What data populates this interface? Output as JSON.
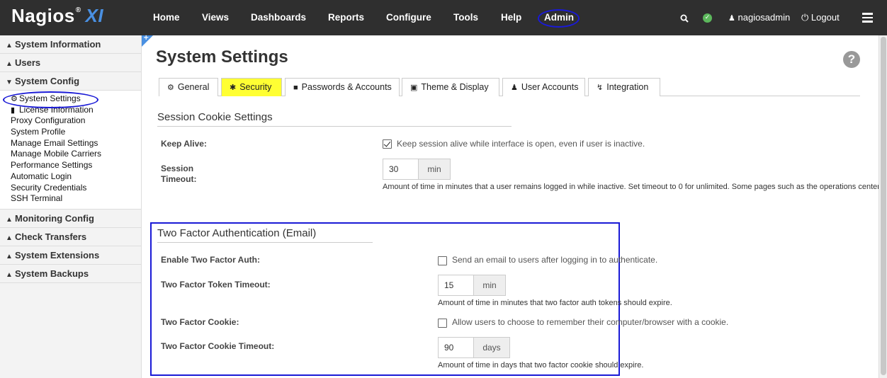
{
  "brand": {
    "name": "Nagios",
    "reg": "®",
    "suffix": "XI"
  },
  "topnav": {
    "items": [
      "Home",
      "Views",
      "Dashboards",
      "Reports",
      "Configure",
      "Tools",
      "Help",
      "Admin"
    ]
  },
  "topright": {
    "user": "nagiosadmin",
    "logout": "Logout"
  },
  "sidebar": {
    "sections": [
      "System Information",
      "Users",
      "System Config",
      "Monitoring Config",
      "Check Transfers",
      "System Extensions",
      "System Backups"
    ],
    "system_config_items": [
      "System Settings",
      "License Information",
      "Proxy Configuration",
      "System Profile",
      "Manage Email Settings",
      "Manage Mobile Carriers",
      "Performance Settings",
      "Automatic Login",
      "Security Credentials",
      "SSH Terminal"
    ]
  },
  "page": {
    "title": "System Settings",
    "help": "?"
  },
  "tabs": [
    "General",
    "Security",
    "Passwords & Accounts",
    "Theme & Display",
    "User Accounts",
    "Integration"
  ],
  "session": {
    "heading": "Session Cookie Settings",
    "keep_alive_label": "Keep Alive:",
    "keep_alive_text": "Keep session alive while interface is open, even if user is inactive.",
    "keep_alive_checked": true,
    "timeout_label_1": "Session",
    "timeout_label_2": "Timeout:",
    "timeout_value": "30",
    "timeout_unit": "min",
    "timeout_help": "Amount of time in minutes that a user remains logged in while inactive. Set timeout to 0 for unlimited. Some pages such as the operations center will not log users out for inactivity."
  },
  "tfa": {
    "heading": "Two Factor Authentication (Email)",
    "enable_label": "Enable Two Factor Auth:",
    "enable_text": "Send an email to users after logging in to authenticate.",
    "token_label": "Two Factor Token Timeout:",
    "token_value": "15",
    "token_unit": "min",
    "token_help": "Amount of time in minutes that two factor auth tokens should expire.",
    "cookie_label": "Two Factor Cookie:",
    "cookie_text": "Allow users to choose to remember their computer/browser with a cookie.",
    "cookie_timeout_label": "Two Factor Cookie Timeout:",
    "cookie_timeout_value": "90",
    "cookie_timeout_unit": "days",
    "cookie_timeout_help": "Amount of time in days that two factor cookie should expire."
  },
  "colors": {
    "topbar": "#2f2f2f",
    "accent": "#4a90e2",
    "active_tab": "#ffff33",
    "annotation": "#1a1ad6"
  }
}
